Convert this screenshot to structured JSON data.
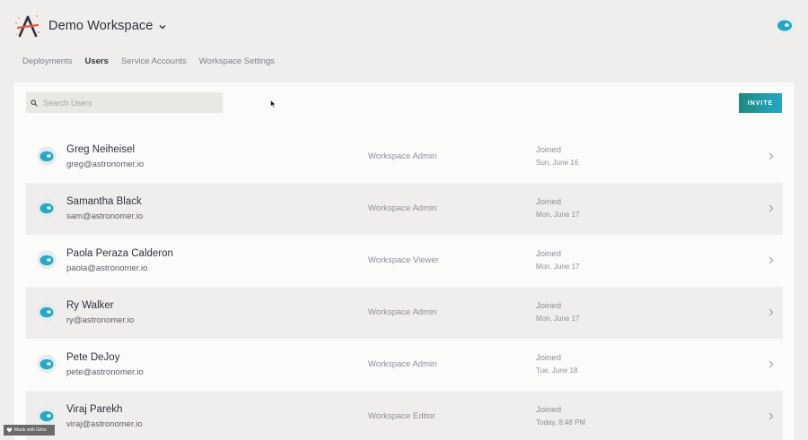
{
  "header": {
    "workspace_name": "Demo Workspace",
    "tabs": [
      "Deployments",
      "Users",
      "Service Accounts",
      "Workspace Settings"
    ],
    "active_tab": "Users"
  },
  "toolbar": {
    "search_placeholder": "Search Users",
    "invite_label": "INVITE"
  },
  "colors": {
    "accent": "#23a8c8",
    "accent_dark": "#1c8a7e",
    "background": "#efeeec",
    "panel": "#fbfbfa"
  },
  "users": [
    {
      "name": "Greg Neiheisel",
      "email": "greg@astronomer.io",
      "role": "Workspace Admin",
      "joined_label": "Joined",
      "joined_date": "Sun, June 16"
    },
    {
      "name": "Samantha Black",
      "email": "sam@astronomer.io",
      "role": "Workspace Admin",
      "joined_label": "Joined",
      "joined_date": "Mon, June 17"
    },
    {
      "name": "Paola Peraza Calderon",
      "email": "paola@astronomer.io",
      "role": "Workspace Viewer",
      "joined_label": "Joined",
      "joined_date": "Mon, June 17"
    },
    {
      "name": "Ry Walker",
      "email": "ry@astronomer.io",
      "role": "Workspace Admin",
      "joined_label": "Joined",
      "joined_date": "Mon, June 17"
    },
    {
      "name": "Pete DeJoy",
      "email": "pete@astronomer.io",
      "role": "Workspace Admin",
      "joined_label": "Joined",
      "joined_date": "Tue, June 18"
    },
    {
      "name": "Viraj Parekh",
      "email": "viraj@astronomer.io",
      "role": "Workspace Editor",
      "joined_label": "Joined",
      "joined_date": "Today, 8:48 PM"
    }
  ],
  "watermark": {
    "text": "Made with Gifox"
  }
}
